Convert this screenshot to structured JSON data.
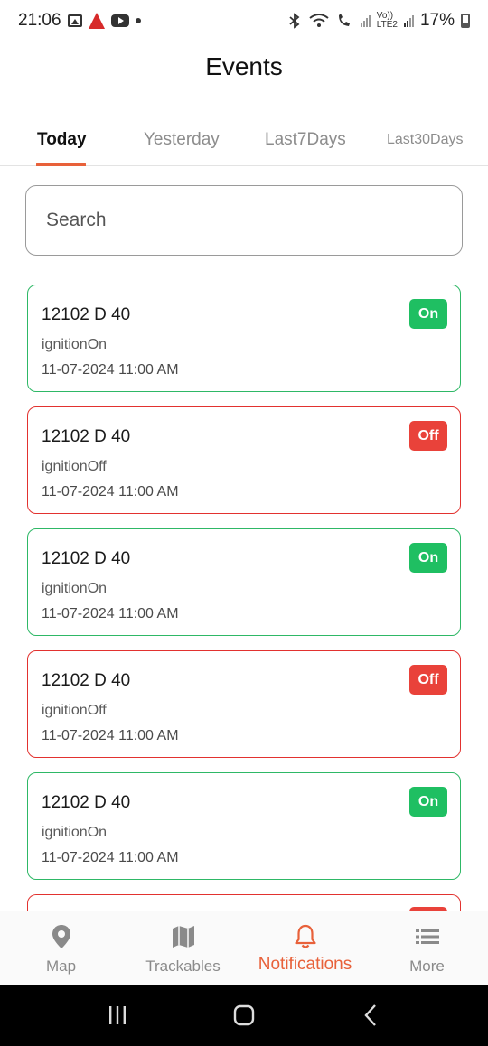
{
  "status_bar": {
    "time": "21:06",
    "volte": "Vo))",
    "lte": "LTE2",
    "battery": "17%"
  },
  "page": {
    "title": "Events"
  },
  "tabs": [
    {
      "label": "Today",
      "active": true
    },
    {
      "label": "Yesterday",
      "active": false
    },
    {
      "label": "Last7Days",
      "active": false
    },
    {
      "label": "Last30Days",
      "active": false
    }
  ],
  "search": {
    "placeholder": "Search"
  },
  "colors": {
    "accent": "#e8613a",
    "on_border": "#2eb866",
    "off_border": "#e2322f",
    "on_badge": "#1fbf62",
    "off_badge": "#e9423a"
  },
  "events": [
    {
      "vehicle": "12102 D 40",
      "type": "ignitionOn",
      "time": "11-07-2024 11:00 AM",
      "badge": "On"
    },
    {
      "vehicle": "12102 D 40",
      "type": "ignitionOff",
      "time": "11-07-2024 11:00 AM",
      "badge": "Off"
    },
    {
      "vehicle": "12102 D 40",
      "type": "ignitionOn",
      "time": "11-07-2024 11:00 AM",
      "badge": "On"
    },
    {
      "vehicle": "12102 D 40",
      "type": "ignitionOff",
      "time": "11-07-2024 11:00 AM",
      "badge": "Off"
    },
    {
      "vehicle": "12102 D 40",
      "type": "ignitionOn",
      "time": "11-07-2024 11:00 AM",
      "badge": "On"
    }
  ],
  "bottom_nav": {
    "items": [
      {
        "label": "Map",
        "icon": "map-pin-icon"
      },
      {
        "label": "Trackables",
        "icon": "folded-map-icon"
      },
      {
        "label": "Notifications",
        "icon": "bell-icon",
        "active": true
      },
      {
        "label": "More",
        "icon": "menu-lines-icon"
      }
    ]
  }
}
